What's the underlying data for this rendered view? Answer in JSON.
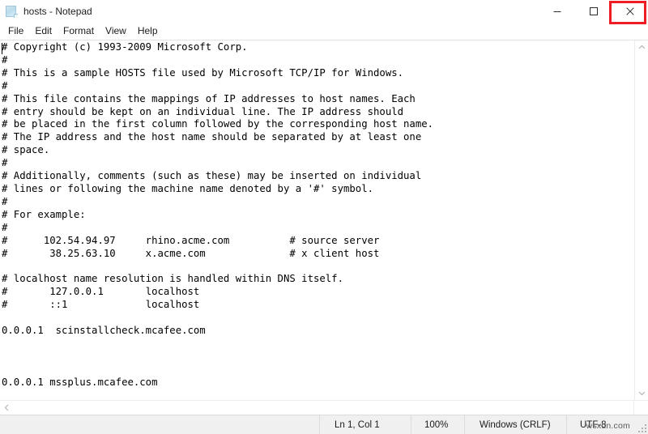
{
  "window": {
    "title": "hosts - Notepad",
    "icon": "notepad-document-icon",
    "controls": {
      "minimize": "Minimize",
      "maximize": "Maximize",
      "close": "Close",
      "close_highlight_color": "#ee1c25"
    }
  },
  "menubar": {
    "items": [
      {
        "label": "File"
      },
      {
        "label": "Edit"
      },
      {
        "label": "Format"
      },
      {
        "label": "View"
      },
      {
        "label": "Help"
      }
    ]
  },
  "editor": {
    "content": "# Copyright (c) 1993-2009 Microsoft Corp.\n#\n# This is a sample HOSTS file used by Microsoft TCP/IP for Windows.\n#\n# This file contains the mappings of IP addresses to host names. Each\n# entry should be kept on an individual line. The IP address should\n# be placed in the first column followed by the corresponding host name.\n# The IP address and the host name should be separated by at least one\n# space.\n#\n# Additionally, comments (such as these) may be inserted on individual\n# lines or following the machine name denoted by a '#' symbol.\n#\n# For example:\n#\n#      102.54.94.97     rhino.acme.com          # source server\n#       38.25.63.10     x.acme.com              # x client host\n\n# localhost name resolution is handled within DNS itself.\n#\t127.0.0.1       localhost\n#\t::1             localhost\n\n0.0.0.1  scinstallcheck.mcafee.com\n\n\n\n0.0.0.1 mssplus.mcafee.com"
  },
  "scrollbars": {
    "vertical": {
      "up_arrow": "scroll-up-chevron-icon",
      "down_arrow": "scroll-down-chevron-icon"
    },
    "horizontal": {
      "left_arrow": "scroll-left-chevron-icon"
    }
  },
  "statusbar": {
    "cursor_position": "Ln 1, Col 1",
    "zoom": "100%",
    "line_ending": "Windows (CRLF)",
    "encoding": "UTF-8"
  },
  "watermark": {
    "text": "wsxdn.com"
  }
}
